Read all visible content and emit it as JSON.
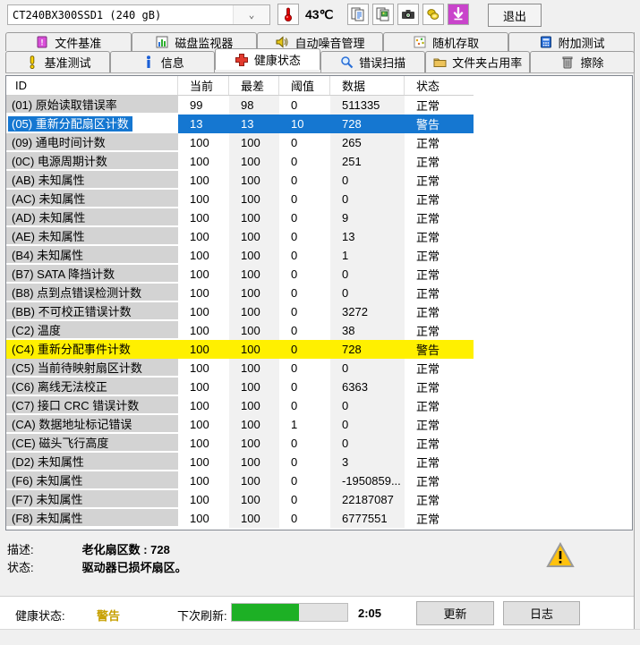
{
  "topbar": {
    "drive_select": "CT240BX300SSD1 (240 gB)",
    "temperature": "43℃",
    "exit_label": "退出",
    "toolbar_icons": [
      "copy-text-icon",
      "copy-image-icon",
      "camera-icon",
      "coins-icon",
      "download-icon"
    ]
  },
  "tabs": {
    "row1": [
      {
        "label": "文件基准",
        "icon": "file-benchmark-icon"
      },
      {
        "label": "磁盘监视器",
        "icon": "disk-monitor-icon"
      },
      {
        "label": "自动噪音管理",
        "icon": "speaker-icon"
      },
      {
        "label": "随机存取",
        "icon": "random-access-icon"
      },
      {
        "label": "附加测试",
        "icon": "extra-tests-icon"
      }
    ],
    "row2": [
      {
        "label": "基准测试",
        "icon": "exclamation-icon"
      },
      {
        "label": "信息",
        "icon": "info-icon"
      },
      {
        "label": "健康状态",
        "icon": "health-cross-icon",
        "active": true
      },
      {
        "label": "错误扫描",
        "icon": "magnifier-icon"
      },
      {
        "label": "文件夹占用率",
        "icon": "folder-icon"
      },
      {
        "label": "擦除",
        "icon": "trash-icon"
      }
    ]
  },
  "table": {
    "columns": [
      "ID",
      "当前",
      "最差",
      "阈值",
      "数据",
      "状态"
    ],
    "rows": [
      {
        "id": "(01) 原始读取错误率",
        "current": "99",
        "worst": "98",
        "threshold": "0",
        "data": "511335",
        "status": "正常",
        "state": "normal"
      },
      {
        "id": "(05) 重新分配扇区计数",
        "current": "13",
        "worst": "13",
        "threshold": "10",
        "data": "728",
        "status": "警告",
        "state": "selected"
      },
      {
        "id": "(09) 通电时间计数",
        "current": "100",
        "worst": "100",
        "threshold": "0",
        "data": "265",
        "status": "正常",
        "state": "normal"
      },
      {
        "id": "(0C) 电源周期计数",
        "current": "100",
        "worst": "100",
        "threshold": "0",
        "data": "251",
        "status": "正常",
        "state": "normal"
      },
      {
        "id": "(AB) 未知属性",
        "current": "100",
        "worst": "100",
        "threshold": "0",
        "data": "0",
        "status": "正常",
        "state": "normal"
      },
      {
        "id": "(AC) 未知属性",
        "current": "100",
        "worst": "100",
        "threshold": "0",
        "data": "0",
        "status": "正常",
        "state": "normal"
      },
      {
        "id": "(AD) 未知属性",
        "current": "100",
        "worst": "100",
        "threshold": "0",
        "data": "9",
        "status": "正常",
        "state": "normal"
      },
      {
        "id": "(AE) 未知属性",
        "current": "100",
        "worst": "100",
        "threshold": "0",
        "data": "13",
        "status": "正常",
        "state": "normal"
      },
      {
        "id": "(B4) 未知属性",
        "current": "100",
        "worst": "100",
        "threshold": "0",
        "data": "1",
        "status": "正常",
        "state": "normal"
      },
      {
        "id": "(B7) SATA 降挡计数",
        "current": "100",
        "worst": "100",
        "threshold": "0",
        "data": "0",
        "status": "正常",
        "state": "normal"
      },
      {
        "id": "(B8) 点到点错误检测计数",
        "current": "100",
        "worst": "100",
        "threshold": "0",
        "data": "0",
        "status": "正常",
        "state": "normal"
      },
      {
        "id": "(BB) 不可校正错误计数",
        "current": "100",
        "worst": "100",
        "threshold": "0",
        "data": "3272",
        "status": "正常",
        "state": "normal"
      },
      {
        "id": "(C2) 温度",
        "current": "100",
        "worst": "100",
        "threshold": "0",
        "data": "38",
        "status": "正常",
        "state": "normal"
      },
      {
        "id": "(C4) 重新分配事件计数",
        "current": "100",
        "worst": "100",
        "threshold": "0",
        "data": "728",
        "status": "警告",
        "state": "warning"
      },
      {
        "id": "(C5) 当前待映射扇区计数",
        "current": "100",
        "worst": "100",
        "threshold": "0",
        "data": "0",
        "status": "正常",
        "state": "normal"
      },
      {
        "id": "(C6) 离线无法校正",
        "current": "100",
        "worst": "100",
        "threshold": "0",
        "data": "6363",
        "status": "正常",
        "state": "normal"
      },
      {
        "id": "(C7) 接口 CRC 错误计数",
        "current": "100",
        "worst": "100",
        "threshold": "0",
        "data": "0",
        "status": "正常",
        "state": "normal"
      },
      {
        "id": "(CA) 数据地址标记错误",
        "current": "100",
        "worst": "100",
        "threshold": "1",
        "data": "0",
        "status": "正常",
        "state": "normal"
      },
      {
        "id": "(CE) 磁头飞行高度",
        "current": "100",
        "worst": "100",
        "threshold": "0",
        "data": "0",
        "status": "正常",
        "state": "normal"
      },
      {
        "id": "(D2) 未知属性",
        "current": "100",
        "worst": "100",
        "threshold": "0",
        "data": "3",
        "status": "正常",
        "state": "normal"
      },
      {
        "id": "(F6) 未知属性",
        "current": "100",
        "worst": "100",
        "threshold": "0",
        "data": "-1950859...",
        "status": "正常",
        "state": "normal"
      },
      {
        "id": "(F7) 未知属性",
        "current": "100",
        "worst": "100",
        "threshold": "0",
        "data": "22187087",
        "status": "正常",
        "state": "normal"
      },
      {
        "id": "(F8) 未知属性",
        "current": "100",
        "worst": "100",
        "threshold": "0",
        "data": "6777551",
        "status": "正常",
        "state": "normal"
      }
    ]
  },
  "details": {
    "desc_label": "描述:",
    "desc_value": "老化扇区数 : 728",
    "status_label": "状态:",
    "status_value": "驱动器已损坏扇区。"
  },
  "footer": {
    "health_label": "健康状态:",
    "health_value": "警告",
    "refresh_label": "下次刷新:",
    "refresh_progress": 58,
    "countdown": "2:05",
    "update_label": "更新",
    "log_label": "日志"
  },
  "colors": {
    "selection_blue": "#1577d1",
    "warning_row_yellow": "#fff000",
    "health_warning_text": "#c7a000",
    "progress_green": "#1db025",
    "download_button_magenta": "#c944cb"
  }
}
